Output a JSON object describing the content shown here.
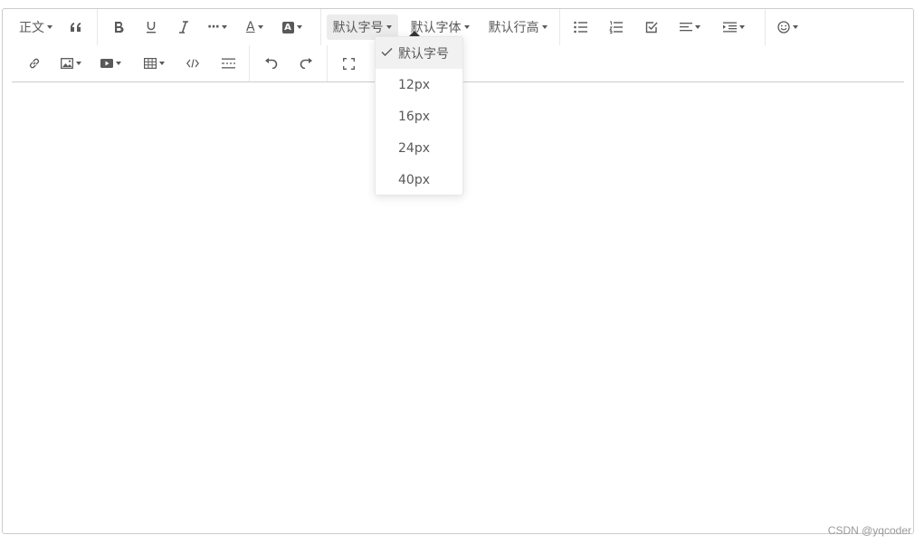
{
  "toolbar": {
    "row1": {
      "header_label": "正文",
      "bold_icon": "bold-icon",
      "underline_icon": "underline-icon",
      "italic_icon": "italic-icon",
      "more_label": "···",
      "font_color_label": "A",
      "bg_color_label": "A",
      "font_size_label": "默认字号",
      "font_family_label": "默认字体",
      "line_height_label": "默认行高"
    },
    "row2": {
      "icons": [
        "link-icon",
        "image-icon",
        "video-icon",
        "table-icon",
        "code-icon",
        "divider-icon",
        "undo-icon",
        "redo-icon",
        "fullscreen-icon"
      ]
    }
  },
  "font_size_menu": {
    "items": [
      {
        "label": "默认字号",
        "selected": true
      },
      {
        "label": "12px",
        "selected": false
      },
      {
        "label": "16px",
        "selected": false
      },
      {
        "label": "24px",
        "selected": false
      },
      {
        "label": "40px",
        "selected": false
      }
    ]
  },
  "watermark": "CSDN @yqcoder"
}
